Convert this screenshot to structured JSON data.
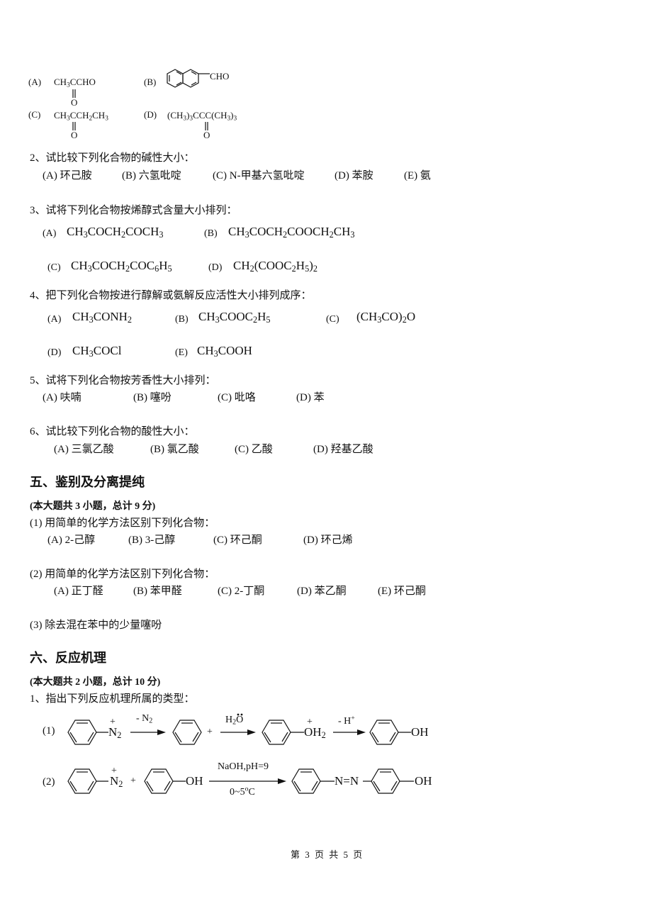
{
  "q1_options": {
    "A": {
      "label": "(A)",
      "formula": "CH3CCHO",
      "carbonyl": "O"
    },
    "B": {
      "label": "(B)",
      "substituent": "CHO",
      "structure": "2-naphthaldehyde"
    },
    "C": {
      "label": "(C)",
      "formula": "CH3CCH2CH3",
      "carbonyl": "O"
    },
    "D": {
      "label": "(D)",
      "formula": "(CH3)3CCC(CH3)3",
      "carbonyl": "O"
    }
  },
  "q2": {
    "title": "2、试比较下列化合物的碱性大小：",
    "options": [
      "(A)  环己胺",
      "(B)  六氢吡啶",
      "(C) N-甲基六氢吡啶",
      "(D)  苯胺",
      "(E)  氨"
    ]
  },
  "q3": {
    "title": "3、试将下列化合物按烯醇式含量大小排列：",
    "options": [
      {
        "label": "(A)",
        "formula": "CH3COCH2COCH3"
      },
      {
        "label": "(B)",
        "formula": "CH3COCH2COOCH2CH3"
      },
      {
        "label": "(C)",
        "formula": "CH3COCH2COC6H5"
      },
      {
        "label": "(D)",
        "formula": "CH2(COOC2H5)2"
      }
    ]
  },
  "q4": {
    "title": "4、把下列化合物按进行醇解或氨解反应活性大小排列成序：",
    "options": [
      {
        "label": "(A)",
        "formula": "CH3CONH2"
      },
      {
        "label": "(B)",
        "formula": "CH3COOC2H5"
      },
      {
        "label": "(C)",
        "formula": "(CH3CO)2O"
      },
      {
        "label": "(D)",
        "formula": "CH3COCl"
      },
      {
        "label": "(E)",
        "formula": "CH3COOH"
      }
    ]
  },
  "q5": {
    "title": "5、试将下列化合物按芳香性大小排列：",
    "options": [
      "(A)  呋喃",
      "(B)  噻吩",
      "(C)  吡咯",
      "(D)  苯"
    ]
  },
  "q6": {
    "title": "6、试比较下列化合物的酸性大小：",
    "options": [
      "(A)  三氯乙酸",
      "(B)  氯乙酸",
      "(C)  乙酸",
      "(D)  羟基乙酸"
    ]
  },
  "section5": {
    "heading": "五、鉴别及分离提纯",
    "subtitle": "(本大题共 3 小题，总计 9 分)",
    "p1": {
      "title": "(1)  用简单的化学方法区别下列化合物：",
      "options": [
        "(A) 2-己醇",
        "(B) 3-己醇",
        "(C)  环己酮",
        "(D)  环己烯"
      ]
    },
    "p2": {
      "title": "(2)   用简单的化学方法区别下列化合物：",
      "options": [
        "(A)  正丁醛",
        "(B)  苯甲醛",
        "(C) 2-丁酮",
        "(D)  苯乙酮",
        "(E)  环己酮"
      ]
    },
    "p3": {
      "title": "(3)  除去混在苯中的少量噻吩"
    }
  },
  "section6": {
    "heading": "六、反应机理",
    "subtitle": "(本大题共 2 小题，总计 10 分)",
    "p1_title": "1、指出下列反应机理所属的类型：",
    "rxn1": {
      "label": "(1)",
      "diazonium": "N2",
      "plus_charge": "+",
      "step1_reagent": "- N2",
      "plus_sign": "+",
      "step2_reagent": "H2O",
      "oxonium": "OH2",
      "step3_reagent": "- H+",
      "product": "OH"
    },
    "rxn2": {
      "label": "(2)",
      "diazonium": "N2",
      "plus_charge": "+",
      "plus_sign": "+",
      "phenol": "OH",
      "condition_top": "NaOH,pH=9",
      "condition_bottom": "0~5°C",
      "azo": "N=N",
      "product_oh": "OH"
    }
  },
  "footer": {
    "page_text": "第 3 页 共 5 页"
  }
}
